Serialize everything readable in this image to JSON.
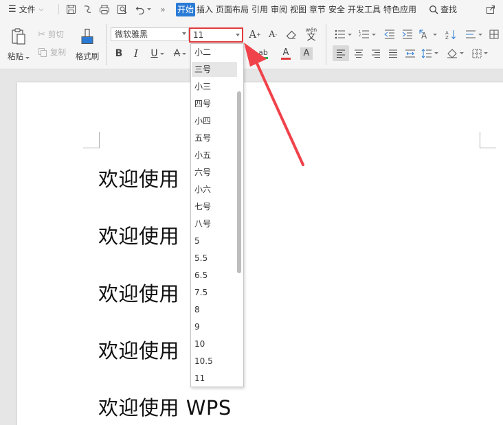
{
  "menubar": {
    "file_label": "文件",
    "tabs": [
      "开始",
      "插入",
      "页面布局",
      "引用",
      "审阅",
      "视图",
      "章节",
      "安全",
      "开发工具",
      "特色应用"
    ],
    "active_tab": "开始",
    "search_label": "查找"
  },
  "clipboard": {
    "paste_label": "粘贴",
    "cut_label": "剪切",
    "copy_label": "复制",
    "format_painter_label": "格式刷"
  },
  "font": {
    "family_value": "微软雅黑",
    "size_value": "11"
  },
  "font_size_dropdown": {
    "options": [
      "小二",
      "三号",
      "小三",
      "四号",
      "小四",
      "五号",
      "小五",
      "六号",
      "小六",
      "七号",
      "八号",
      "5",
      "5.5",
      "6.5",
      "7.5",
      "8",
      "9",
      "10",
      "10.5",
      "11"
    ],
    "hovered": "三号"
  },
  "document": {
    "lines": [
      "欢迎使用",
      "欢迎使用",
      "欢迎使用",
      "欢迎使用",
      "欢迎使用 WPS"
    ]
  },
  "colors": {
    "accent": "#2b7bd6",
    "highlight_red": "#e03a3a",
    "annotation_arrow": "#f0424a"
  }
}
